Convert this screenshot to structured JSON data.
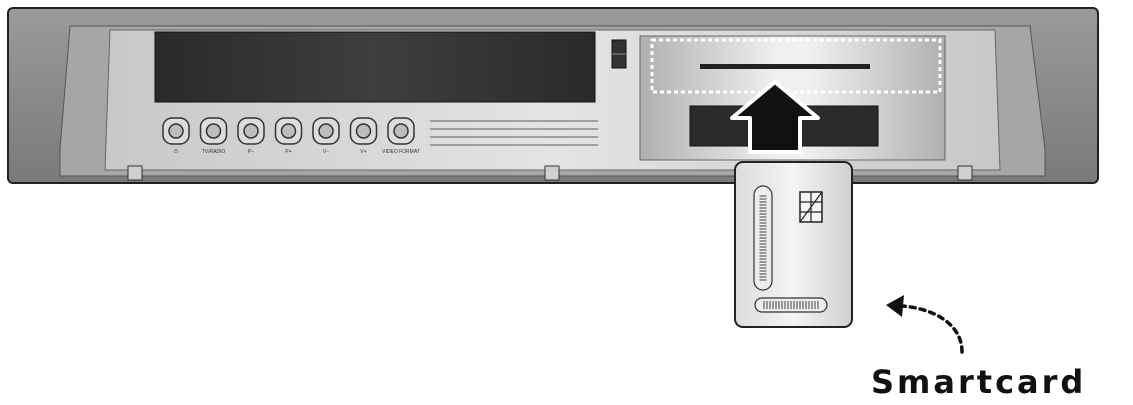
{
  "device": {
    "front_buttons": [
      {
        "label": "⏻",
        "icon": "power-icon"
      },
      {
        "label": "TV/RADIO"
      },
      {
        "label": "P−"
      },
      {
        "label": "P+"
      },
      {
        "label": "V−"
      },
      {
        "label": "V+"
      },
      {
        "label": "VIDEO FORMAT"
      }
    ],
    "card_slot_highlight": "dotted-outline",
    "insert_arrow_icon": "up-arrow-icon"
  },
  "smartcard": {
    "caption": "Smartcard",
    "chip_icon": "chip-icon"
  }
}
